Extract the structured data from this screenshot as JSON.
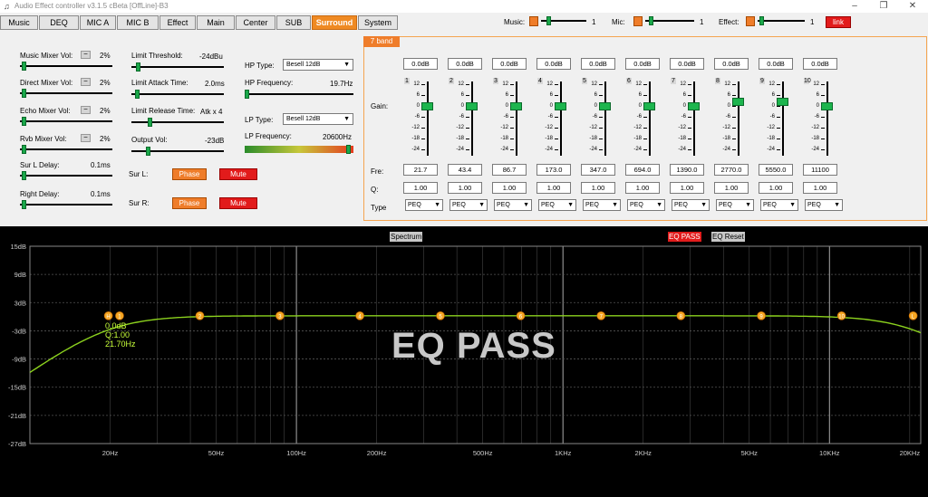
{
  "window": {
    "title": "Audio Effect controller v3.1.5 cBeta [OffLine]-B3"
  },
  "tabs": [
    "Music",
    "DEQ",
    "MIC A",
    "MIC B",
    "Effect",
    "Main",
    "Center",
    "SUB",
    "Surround",
    "System"
  ],
  "active_tab": "Surround",
  "top_controls": {
    "music": {
      "label": "Music:",
      "value": "1"
    },
    "mic": {
      "label": "Mic:",
      "value": "1"
    },
    "effect": {
      "label": "Effect:",
      "value": "1"
    },
    "link_label": "link"
  },
  "left": {
    "mixers": [
      {
        "label": "Music Mixer Vol:",
        "minus": "−",
        "value": "2%"
      },
      {
        "label": "Direct Mixer Vol:",
        "minus": "−",
        "value": "2%"
      },
      {
        "label": "Echo Mixer Vol:",
        "minus": "−",
        "value": "2%"
      },
      {
        "label": "Rvb Mixer Vol:",
        "minus": "−",
        "value": "2%"
      },
      {
        "label": "Sur L Delay:",
        "value": "0.1ms"
      },
      {
        "label": "Right Delay:",
        "value": "0.1ms"
      }
    ],
    "limits": [
      {
        "label": "Limit Threshold:",
        "value": "-24dBu"
      },
      {
        "label": "Limit Attack Time:",
        "value": "2.0ms"
      },
      {
        "label": "Limit Release Time:",
        "value": "Atk x 4"
      },
      {
        "label": "Output Vol:",
        "value": "-23dB"
      }
    ],
    "sur_l": {
      "label": "Sur L:",
      "phase": "Phase",
      "mute": "Mute"
    },
    "sur_r": {
      "label": "Sur R:",
      "phase": "Phase",
      "mute": "Mute"
    },
    "hp": {
      "type_label": "HP Type:",
      "type_value": "Besell 12dB",
      "freq_label": "HP Frequency:",
      "freq_value": "19.7Hz"
    },
    "lp": {
      "type_label": "LP Type:",
      "type_value": "Besell 12dB",
      "freq_label": "LP Frequency:",
      "freq_value": "20600Hz"
    }
  },
  "eq": {
    "title": "7 band",
    "row_labels": {
      "gain": "Gain:",
      "fre": "Fre:",
      "q": "Q:",
      "type": "Type"
    },
    "scale": [
      "12",
      "6",
      "0",
      "-6",
      "-12",
      "-18",
      "-24"
    ],
    "bands": [
      {
        "n": "1",
        "gain": "0.0dB",
        "freq": "21.7",
        "q": "1.00",
        "type": "PEQ"
      },
      {
        "n": "2",
        "gain": "0.0dB",
        "freq": "43.4",
        "q": "1.00",
        "type": "PEQ"
      },
      {
        "n": "3",
        "gain": "0.0dB",
        "freq": "86.7",
        "q": "1.00",
        "type": "PEQ"
      },
      {
        "n": "4",
        "gain": "0.0dB",
        "freq": "173.0",
        "q": "1.00",
        "type": "PEQ"
      },
      {
        "n": "5",
        "gain": "0.0dB",
        "freq": "347.0",
        "q": "1.00",
        "type": "PEQ"
      },
      {
        "n": "6",
        "gain": "0.0dB",
        "freq": "694.0",
        "q": "1.00",
        "type": "PEQ"
      },
      {
        "n": "7",
        "gain": "0.0dB",
        "freq": "1390.0",
        "q": "1.00",
        "type": "PEQ"
      },
      {
        "n": "8",
        "gain": "0.0dB",
        "freq": "2770.0",
        "q": "1.00",
        "type": "PEQ"
      },
      {
        "n": "9",
        "gain": "0.0dB",
        "freq": "5550.0",
        "q": "1.00",
        "type": "PEQ"
      },
      {
        "n": "10",
        "gain": "0.0dB",
        "freq": "11100",
        "q": "1.00",
        "type": "PEQ"
      }
    ]
  },
  "graph": {
    "spectrum_label": "Spectrum",
    "eq_pass_label": "EQ PASS",
    "eq_reset_label": "EQ Reset",
    "watermark": "EQ PASS",
    "readout": {
      "gain": "0.0dB",
      "q": "Q:1.00",
      "freq": "21.70Hz"
    },
    "ylabels": [
      "15dB",
      "9dB",
      "3dB",
      "-3dB",
      "-9dB",
      "-15dB",
      "-21dB",
      "-27dB"
    ],
    "xlabels": [
      "20Hz",
      "50Hz",
      "100Hz",
      "200Hz",
      "500Hz",
      "1KHz",
      "2KHz",
      "5KHz",
      "10KHz",
      "20KHz"
    ],
    "markers": [
      "H",
      "1",
      "2",
      "3",
      "4",
      "5",
      "6",
      "7",
      "8",
      "9",
      "10",
      "L"
    ]
  },
  "colors": {
    "accent": "#ef7d2a",
    "mute": "#e21b1b",
    "knob": "#1aa84a",
    "curve": "#8cd21e"
  }
}
